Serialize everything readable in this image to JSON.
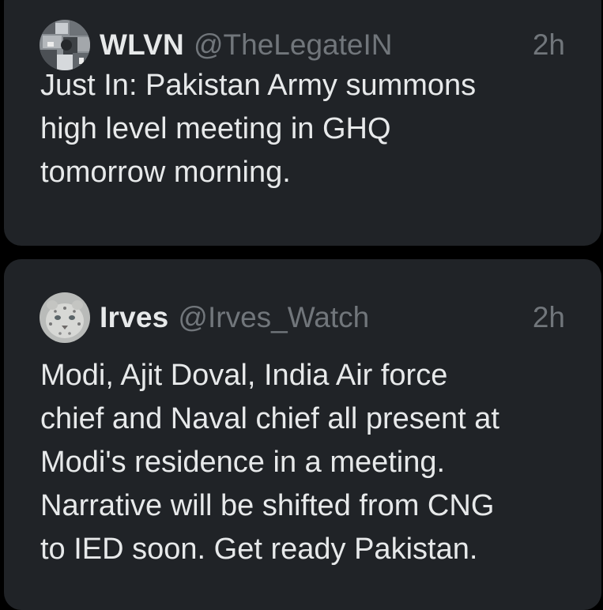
{
  "colors": {
    "background": "#000000",
    "card": "#202327",
    "primary_text": "#e7e9ea",
    "secondary_text": "#71767b"
  },
  "tweets": [
    {
      "avatar_icon": "avatar-wlvn-icon",
      "display_name": "WLVN",
      "handle": "@TheLegateIN",
      "time": "2h",
      "lines": [
        "Just In: Pakistan Army summons",
        "high level meeting in GHQ",
        "tomorrow morning."
      ]
    },
    {
      "avatar_icon": "avatar-snow-leopard-icon",
      "display_name": "Irves",
      "handle": "@Irves_Watch",
      "time": "2h",
      "lines": [
        "Modi, Ajit Doval, India Air force",
        "chief and Naval chief all present at",
        "Modi's residence in a meeting.",
        "Narrative will be shifted from CNG",
        "to IED soon. Get ready Pakistan."
      ]
    }
  ]
}
